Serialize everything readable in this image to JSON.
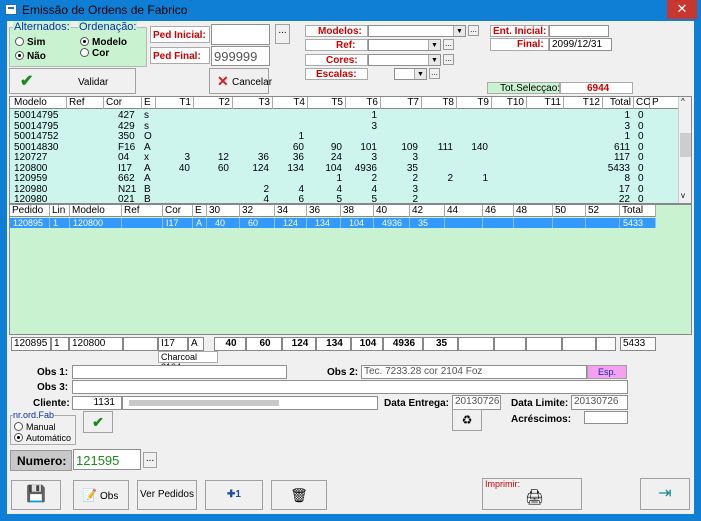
{
  "window": {
    "title": "Emissão de Ordens de Fabrico",
    "close_glyph": "✕"
  },
  "filters": {
    "alternados": {
      "legend": "Alternados:",
      "opt_sim": "Sim",
      "opt_nao": "Não"
    },
    "ordenacao": {
      "legend": "Ordenação:",
      "opt_modelo": "Modelo",
      "opt_cor": "Cor"
    },
    "ped_inicial_label": "Ped Inicial:",
    "ped_inicial_value": "",
    "ped_final_label": "Ped Final:",
    "ped_final_value": "999999",
    "modelos_label": "Modelos:",
    "ref_label": "Ref:",
    "cores_label": "Cores:",
    "escalas_label": "Escalas:",
    "ent_inicial_label": "Ent. Inicial:",
    "ent_inicial_value": "",
    "final_label": "Final:",
    "final_value": "2099/12/31",
    "dots": "..."
  },
  "toolbar": {
    "validar": "Validar",
    "cancelar": "Cancelar",
    "tot_label": "Tot.Selecçao:",
    "tot_value": "6944"
  },
  "grid1": {
    "headers": [
      "Modelo",
      "Ref",
      "Cor",
      "E",
      "T1",
      "T2",
      "T3",
      "T4",
      "T5",
      "T6",
      "T7",
      "T8",
      "T9",
      "T10",
      "T11",
      "T12",
      "Total",
      "CC",
      "P"
    ],
    "rows": [
      [
        "50014795",
        "",
        "427",
        "s",
        "",
        "",
        "",
        "",
        "",
        "1",
        "",
        "",
        "",
        "",
        "",
        "",
        "1",
        "0",
        ""
      ],
      [
        "50014795",
        "",
        "429",
        "s",
        "",
        "",
        "",
        "",
        "",
        "3",
        "",
        "",
        "",
        "",
        "",
        "",
        "3",
        "0",
        ""
      ],
      [
        "50014752",
        "",
        "350",
        "O",
        "",
        "",
        "",
        "1",
        "",
        "",
        "",
        "",
        "",
        "",
        "",
        "",
        "1",
        "0",
        ""
      ],
      [
        "50014830",
        "",
        "F16",
        "A",
        "",
        "",
        "",
        "60",
        "90",
        "101",
        "109",
        "111",
        "140",
        "",
        "",
        "",
        "611",
        "0",
        ""
      ],
      [
        "120727",
        "",
        "04",
        "x",
        "3",
        "12",
        "36",
        "36",
        "24",
        "3",
        "3",
        "",
        "",
        "",
        "",
        "",
        "117",
        "0",
        ""
      ],
      [
        "120800",
        "",
        "I17",
        "A",
        "40",
        "60",
        "124",
        "134",
        "104",
        "4936",
        "35",
        "",
        "",
        "",
        "",
        "",
        "5433",
        "0",
        ""
      ],
      [
        "120959",
        "",
        "662",
        "A",
        "",
        "",
        "",
        "",
        "1",
        "2",
        "2",
        "2",
        "1",
        "",
        "",
        "",
        "8",
        "0",
        ""
      ],
      [
        "120980",
        "",
        "N21",
        "B",
        "",
        "",
        "2",
        "4",
        "4",
        "4",
        "3",
        "",
        "",
        "",
        "",
        "",
        "17",
        "0",
        ""
      ],
      [
        "120980",
        "",
        "021",
        "B",
        "",
        "",
        "4",
        "6",
        "5",
        "5",
        "2",
        "",
        "",
        "",
        "",
        "",
        "22",
        "0",
        ""
      ]
    ]
  },
  "grid2": {
    "headers": [
      "Pedido",
      "Lin",
      "Modelo",
      "Ref",
      "Cor",
      "E",
      "30",
      "32",
      "34",
      "36",
      "38",
      "40",
      "42",
      "44",
      "46",
      "48",
      "50",
      "52",
      "Total"
    ],
    "rows": [
      [
        "120895",
        "1",
        "120800",
        "",
        "I17",
        "A",
        "40",
        "60",
        "124",
        "134",
        "104",
        "4936",
        "35",
        "",
        "",
        "",
        "",
        "",
        "5433"
      ]
    ]
  },
  "summary": {
    "values": [
      "120895",
      "1",
      "120800",
      "",
      "I17",
      "A",
      "40",
      "60",
      "124",
      "134",
      "104",
      "4936",
      "35",
      "",
      "",
      "",
      "",
      "",
      "5433"
    ],
    "desc": "Charcoal 2104"
  },
  "form": {
    "obs1_label": "Obs 1:",
    "obs1_value": "",
    "obs2_label": "Obs 2:",
    "obs2_value": "Tec. 7233.28 cor 2104 Foz",
    "esp_label": "Esp.",
    "obs3_label": "Obs 3:",
    "obs3_value": "",
    "cliente_label": "Cliente:",
    "cliente_code": "1131",
    "data_entrega_label": "Data Entrega:",
    "data_entrega_value": "20130726",
    "data_limite_label": "Data Limite:",
    "data_limite_value": "20130726",
    "acrescimos_label": "Acréscimos:",
    "acrescimos_value": "",
    "nrord_legend": "nr.ord.Fab",
    "opt_manual": "Manual",
    "opt_auto": "Automático",
    "numero_label": "Numero:",
    "numero_value": "121595"
  },
  "bottom": {
    "obs_btn": "Obs",
    "ver_pedidos": "Ver Pedidos",
    "imprimir_label": "Imprimir:"
  },
  "colors": {
    "header_red": "#cc0000",
    "accent_blue": "#0f7fd6",
    "grid_cyan": "#cdf5ee",
    "grid_green": "#c9f2d0",
    "selected_row": "#3399ff",
    "esp_pink": "#f5a0f0"
  }
}
